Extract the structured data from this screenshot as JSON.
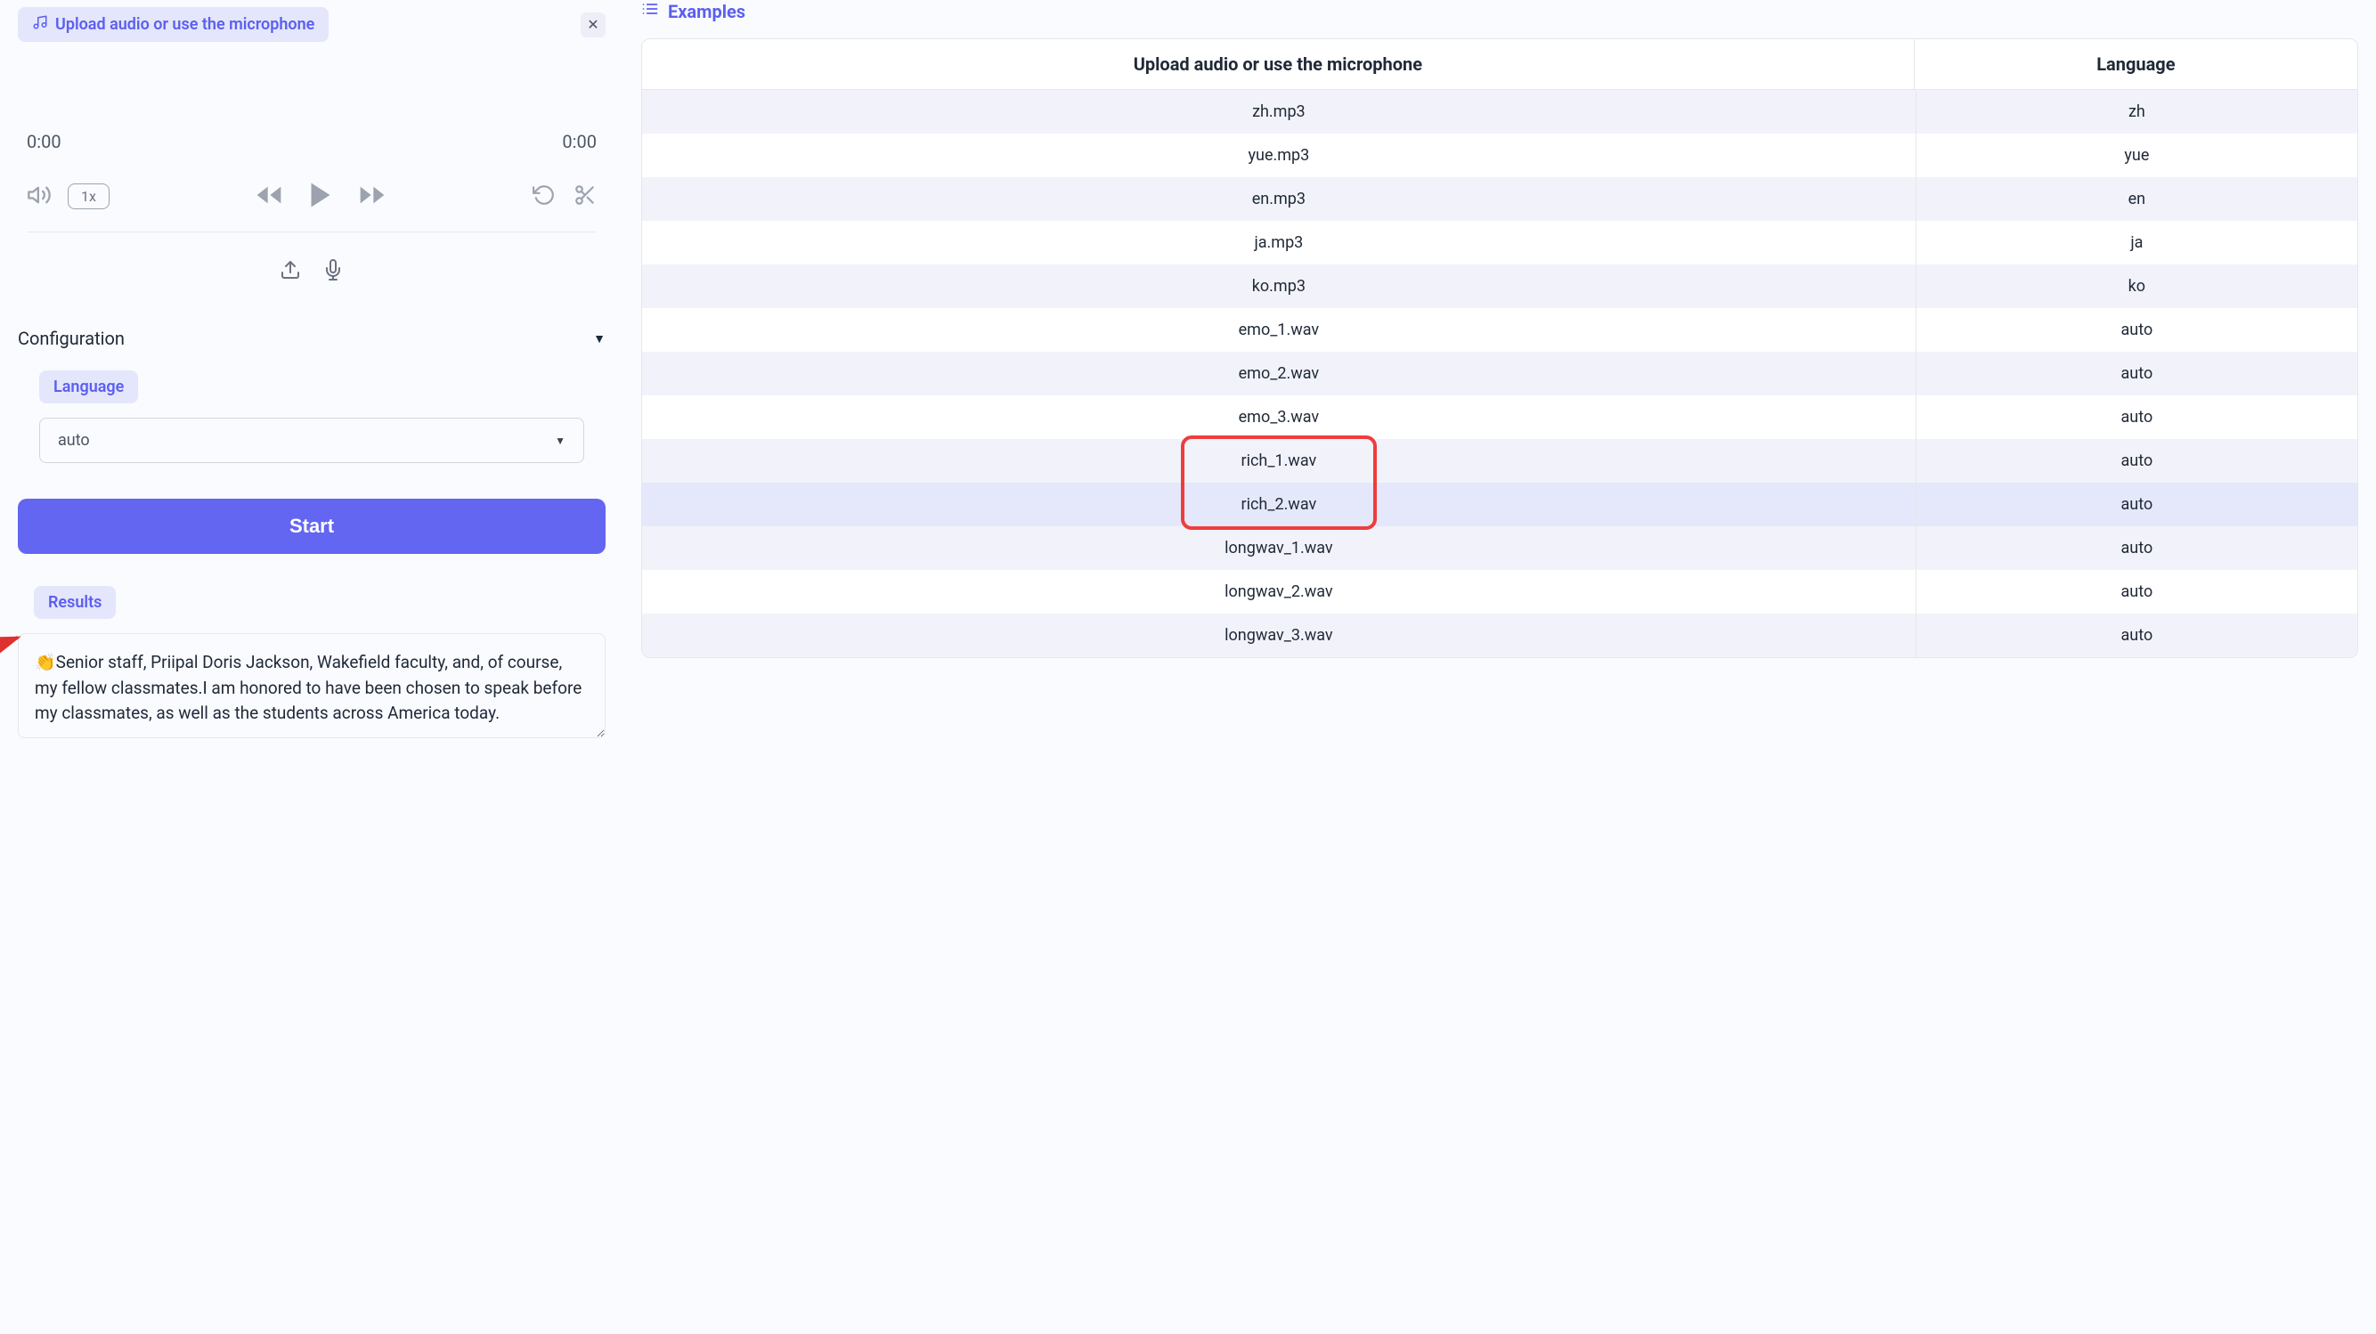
{
  "upload": {
    "label": "Upload audio or use the microphone"
  },
  "player": {
    "start_time": "0:00",
    "end_time": "0:00",
    "speed": "1x"
  },
  "config": {
    "header": "Configuration",
    "lang_label": "Language",
    "lang_value": "auto"
  },
  "start_button": "Start",
  "results": {
    "label": "Results",
    "emoji": "👏",
    "text": "Senior staff, Priipal Doris Jackson, Wakefield faculty, and, of course, my fellow classmates.I am honored to have been chosen to speak before my classmates, as well as the students across America today."
  },
  "examples": {
    "header": "Examples",
    "col_audio": "Upload audio or use the microphone",
    "col_lang": "Language",
    "rows": [
      {
        "file": "zh.mp3",
        "lang": "zh",
        "selected": false
      },
      {
        "file": "yue.mp3",
        "lang": "yue",
        "selected": false
      },
      {
        "file": "en.mp3",
        "lang": "en",
        "selected": false
      },
      {
        "file": "ja.mp3",
        "lang": "ja",
        "selected": false
      },
      {
        "file": "ko.mp3",
        "lang": "ko",
        "selected": false
      },
      {
        "file": "emo_1.wav",
        "lang": "auto",
        "selected": false
      },
      {
        "file": "emo_2.wav",
        "lang": "auto",
        "selected": false
      },
      {
        "file": "emo_3.wav",
        "lang": "auto",
        "selected": false
      },
      {
        "file": "rich_1.wav",
        "lang": "auto",
        "selected": false
      },
      {
        "file": "rich_2.wav",
        "lang": "auto",
        "selected": true
      },
      {
        "file": "longwav_1.wav",
        "lang": "auto",
        "selected": false
      },
      {
        "file": "longwav_2.wav",
        "lang": "auto",
        "selected": false
      },
      {
        "file": "longwav_3.wav",
        "lang": "auto",
        "selected": false
      }
    ]
  }
}
